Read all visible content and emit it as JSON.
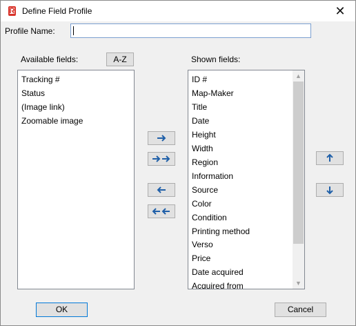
{
  "window": {
    "title": "Define Field Profile",
    "close_glyph": "✕"
  },
  "profile": {
    "label": "Profile Name:",
    "value": ""
  },
  "available": {
    "label": "Available fields:",
    "sort_button": "A-Z",
    "items": [
      "Tracking #",
      "Status",
      "(Image link)",
      "Zoomable image"
    ]
  },
  "shown": {
    "label": "Shown fields:",
    "items": [
      "ID #",
      "Map-Maker",
      "Title",
      "Date",
      "Height",
      "Width",
      "Region",
      "Information",
      "Source",
      "Color",
      "Condition",
      "Printing method",
      "Verso",
      "Price",
      "Date acquired",
      "Acquired from"
    ]
  },
  "transfer_buttons": {
    "add_icon": "arrow-right-icon",
    "add_all_icon": "double-arrow-right-icon",
    "remove_icon": "arrow-left-icon",
    "remove_all_icon": "double-arrow-left-icon"
  },
  "order_buttons": {
    "up_icon": "arrow-up-icon",
    "down_icon": "arrow-down-icon"
  },
  "footer": {
    "ok": "OK",
    "cancel": "Cancel"
  },
  "colors": {
    "arrow": "#1f5fa8",
    "focus_border": "#0078d7",
    "titlebar": "#ffffff",
    "dialog_bg": "#f0f0f0"
  }
}
